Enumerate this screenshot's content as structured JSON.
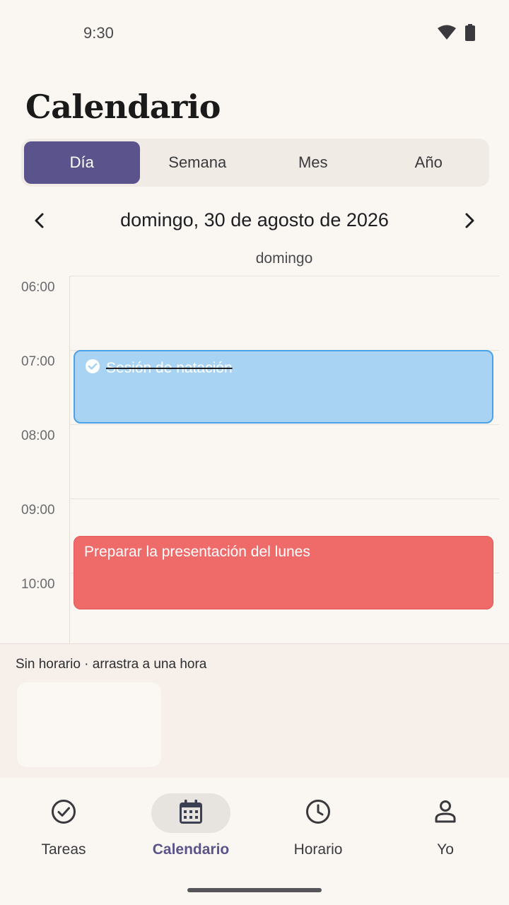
{
  "status_bar": {
    "time": "9:30",
    "icons": [
      "wifi-icon",
      "battery-icon"
    ]
  },
  "header": {
    "title": "Calendario"
  },
  "view_tabs": [
    {
      "label": "Día",
      "active": true
    },
    {
      "label": "Semana",
      "active": false
    },
    {
      "label": "Mes",
      "active": false
    },
    {
      "label": "Año",
      "active": false
    }
  ],
  "date_nav": {
    "label": "domingo, 30 de agosto de 2026",
    "prev_icon": "chevron-left-icon",
    "next_icon": "chevron-right-icon"
  },
  "day_view": {
    "day_header": "domingo",
    "hours": [
      "06:00",
      "07:00",
      "08:00",
      "09:00",
      "10:00"
    ],
    "events": [
      {
        "title": "Sesión de natación",
        "start": "07:00",
        "end": "08:00",
        "completed": true,
        "color": "#A8D3F2"
      },
      {
        "title": "Preparar la presentación del lunes",
        "start": "09:30",
        "end": "10:30",
        "completed": false,
        "color": "#EF6B6A"
      }
    ]
  },
  "unscheduled": {
    "label": "Sin horario · arrastra a una hora"
  },
  "bottom_nav": [
    {
      "label": "Tareas",
      "icon": "check-circle-icon",
      "active": false
    },
    {
      "label": "Calendario",
      "icon": "calendar-icon",
      "active": true
    },
    {
      "label": "Horario",
      "icon": "clock-icon",
      "active": false
    },
    {
      "label": "Yo",
      "icon": "person-icon",
      "active": false
    }
  ],
  "colors": {
    "accent": "#5B548C",
    "background": "#FAF7F2"
  }
}
